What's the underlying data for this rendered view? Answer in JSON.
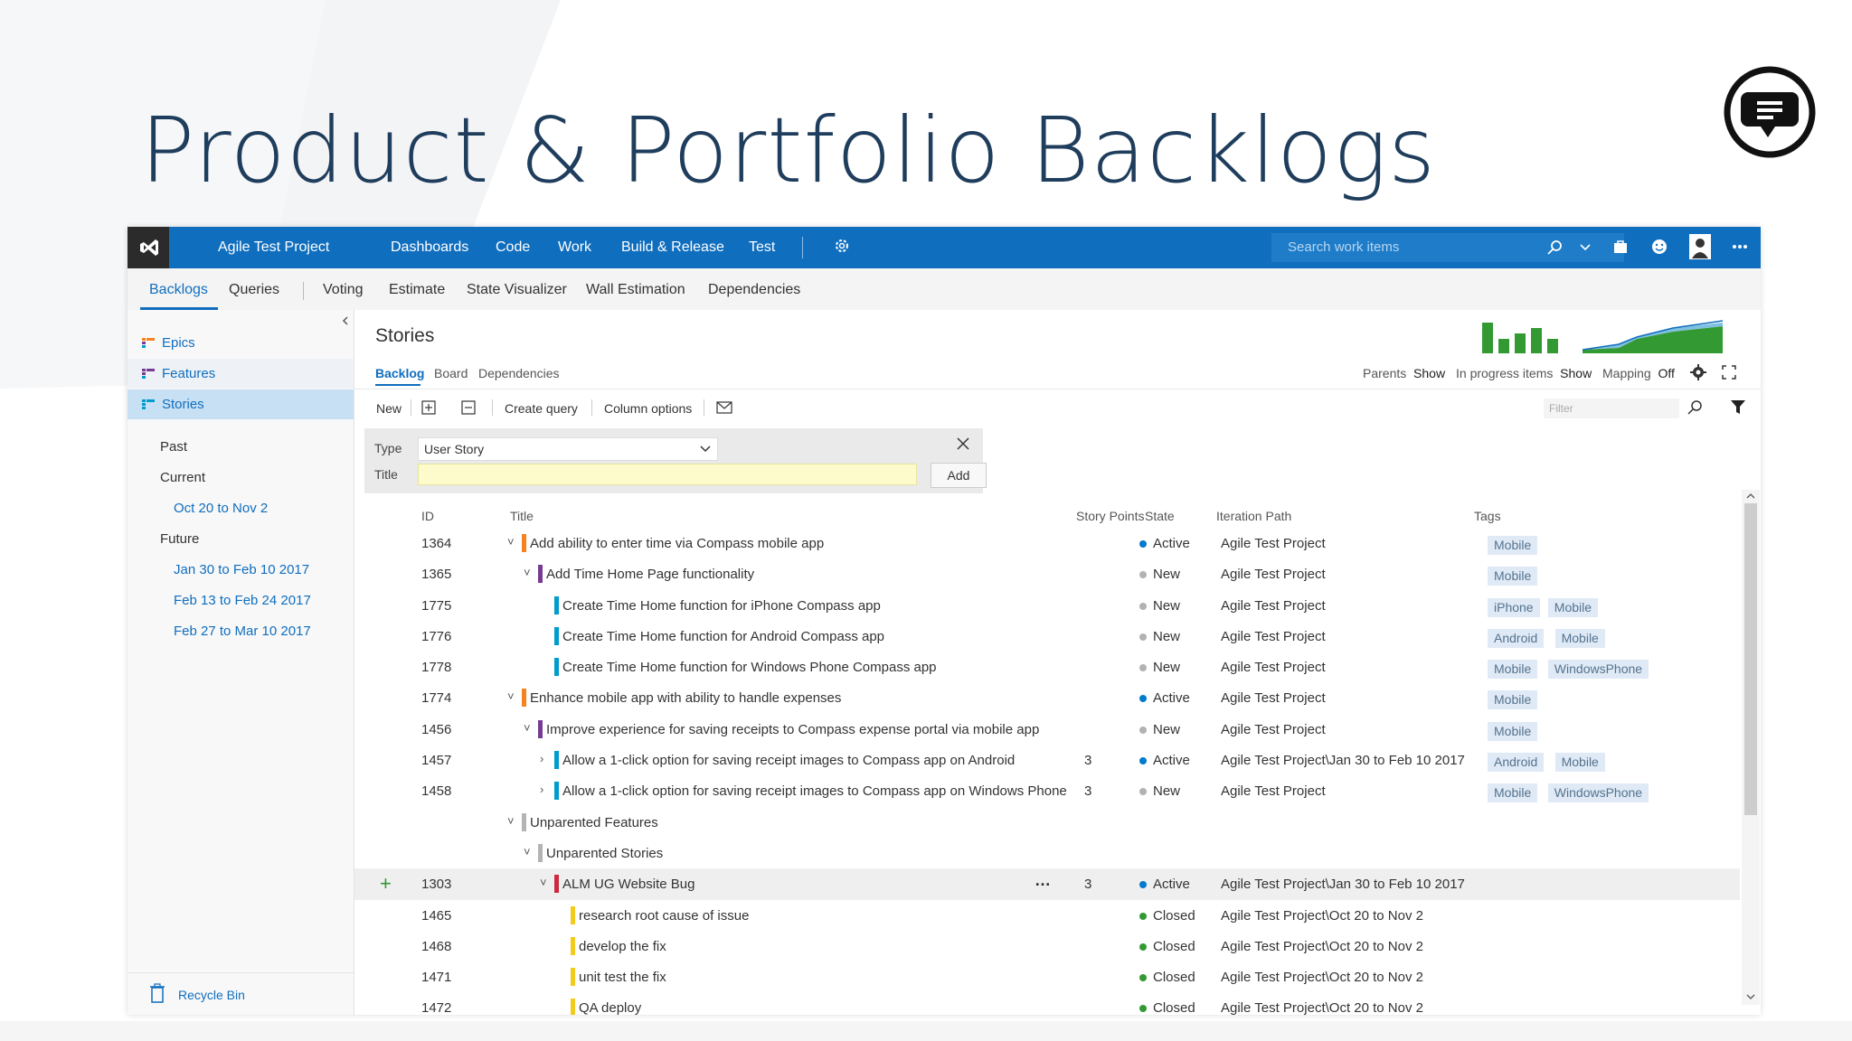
{
  "slide": {
    "title": "Product & Portfolio Backlogs"
  },
  "topbar": {
    "project": "Agile Test Project",
    "nav": [
      "Dashboards",
      "Code",
      "Work",
      "Build & Release",
      "Test"
    ],
    "search_placeholder": "Search work items"
  },
  "subnav": {
    "items": [
      "Backlogs",
      "Queries",
      "Voting",
      "Estimate",
      "State Visualizer",
      "Wall Estimation",
      "Dependencies"
    ],
    "active": "Backlogs"
  },
  "sidebar": {
    "backlogs": [
      "Epics",
      "Features",
      "Stories"
    ],
    "selected": "Stories",
    "sections": {
      "past": "Past",
      "current": "Current",
      "future": "Future"
    },
    "current_iterations": [
      "Oct 20 to Nov 2"
    ],
    "future_iterations": [
      "Jan 30 to Feb 10 2017",
      "Feb 13 to Feb 24 2017",
      "Feb 27 to Mar 10 2017"
    ],
    "recycle": "Recycle Bin"
  },
  "main": {
    "title": "Stories",
    "pivots": [
      "Backlog",
      "Board",
      "Dependencies"
    ],
    "options": {
      "parents_label": "Parents",
      "parents_value": "Show",
      "inprogress_label": "In progress items",
      "inprogress_value": "Show",
      "mapping_label": "Mapping",
      "mapping_value": "Off"
    },
    "toolbar": {
      "new": "New",
      "create_query": "Create query",
      "column_options": "Column options",
      "filter_placeholder": "Filter"
    },
    "add_panel": {
      "type_label": "Type",
      "type_value": "User Story",
      "title_label": "Title",
      "add": "Add"
    },
    "columns": [
      "ID",
      "Title",
      "Story Points",
      "State",
      "Iteration Path",
      "Tags"
    ]
  },
  "rows": [
    {
      "id": "1364",
      "title": "Add ability to enter time via Compass mobile app",
      "level": 0,
      "chev": "down",
      "color": "#f7831f",
      "sp": "",
      "state": "Active",
      "iter": "Agile Test Project",
      "tags": [
        "Mobile"
      ]
    },
    {
      "id": "1365",
      "title": "Add Time Home Page functionality",
      "level": 1,
      "chev": "down",
      "color": "#773b93",
      "sp": "",
      "state": "New",
      "iter": "Agile Test Project",
      "tags": [
        "Mobile"
      ]
    },
    {
      "id": "1775",
      "title": "Create Time Home function for iPhone Compass app",
      "level": 2,
      "chev": "",
      "color": "#009ccc",
      "sp": "",
      "state": "New",
      "iter": "Agile Test Project",
      "tags": [
        "iPhone",
        "Mobile"
      ]
    },
    {
      "id": "1776",
      "title": "Create Time Home function for Android Compass app",
      "level": 2,
      "chev": "",
      "color": "#009ccc",
      "sp": "",
      "state": "New",
      "iter": "Agile Test Project",
      "tags": [
        "Android",
        "Mobile"
      ]
    },
    {
      "id": "1778",
      "title": "Create Time Home function for Windows Phone Compass app",
      "level": 2,
      "chev": "",
      "color": "#009ccc",
      "sp": "",
      "state": "New",
      "iter": "Agile Test Project",
      "tags": [
        "Mobile",
        "WindowsPhone"
      ]
    },
    {
      "id": "1774",
      "title": "Enhance mobile app with ability to handle expenses",
      "level": 0,
      "chev": "down",
      "color": "#f7831f",
      "sp": "",
      "state": "Active",
      "iter": "Agile Test Project",
      "tags": [
        "Mobile"
      ]
    },
    {
      "id": "1456",
      "title": "Improve experience for saving receipts to Compass expense portal via mobile app",
      "level": 1,
      "chev": "down",
      "color": "#773b93",
      "sp": "",
      "state": "New",
      "iter": "Agile Test Project",
      "tags": [
        "Mobile"
      ]
    },
    {
      "id": "1457",
      "title": "Allow a 1-click option for saving receipt images to Compass app on Android",
      "level": 2,
      "chev": "right",
      "color": "#009ccc",
      "sp": "3",
      "state": "Active",
      "iter": "Agile Test Project\\Jan 30 to Feb 10 2017",
      "tags": [
        "Android",
        "Mobile"
      ]
    },
    {
      "id": "1458",
      "title": "Allow a 1-click option for saving receipt images to Compass app on Windows Phone",
      "level": 2,
      "chev": "right",
      "color": "#009ccc",
      "sp": "3",
      "state": "New",
      "iter": "Agile Test Project",
      "tags": [
        "Mobile",
        "WindowsPhone"
      ]
    },
    {
      "id": "",
      "title": "Unparented Features",
      "level": 0,
      "chev": "down",
      "color": "#b4b4b4",
      "sp": "",
      "state": "",
      "iter": "",
      "tags": []
    },
    {
      "id": "",
      "title": "Unparented Stories",
      "level": 1,
      "chev": "down",
      "color": "#b4b4b4",
      "sp": "",
      "state": "",
      "iter": "",
      "tags": []
    },
    {
      "id": "1303",
      "title": "ALM UG Website Bug",
      "level": 2,
      "chev": "down",
      "color": "#cc293d",
      "sp": "3",
      "state": "Active",
      "iter": "Agile Test Project\\Jan 30 to Feb 10 2017",
      "tags": [],
      "highlight": true
    },
    {
      "id": "1465",
      "title": "research root cause of issue",
      "level": 3,
      "chev": "",
      "color": "#f2cb1d",
      "sp": "",
      "state": "Closed",
      "iter": "Agile Test Project\\Oct 20 to Nov 2",
      "tags": []
    },
    {
      "id": "1468",
      "title": "develop the fix",
      "level": 3,
      "chev": "",
      "color": "#f2cb1d",
      "sp": "",
      "state": "Closed",
      "iter": "Agile Test Project\\Oct 20 to Nov 2",
      "tags": []
    },
    {
      "id": "1471",
      "title": "unit test the fix",
      "level": 3,
      "chev": "",
      "color": "#f2cb1d",
      "sp": "",
      "state": "Closed",
      "iter": "Agile Test Project\\Oct 20 to Nov 2",
      "tags": []
    },
    {
      "id": "1472",
      "title": "QA deploy",
      "level": 3,
      "chev": "",
      "color": "#f2cb1d",
      "sp": "",
      "state": "Closed",
      "iter": "Agile Test Project\\Oct 20 to Nov 2",
      "tags": []
    }
  ],
  "colors": {
    "accent": "#106ebe",
    "active_dot": "#007acc",
    "new_dot": "#b2b2b2",
    "closed_dot": "#339933",
    "title": "#1f3d5c"
  }
}
